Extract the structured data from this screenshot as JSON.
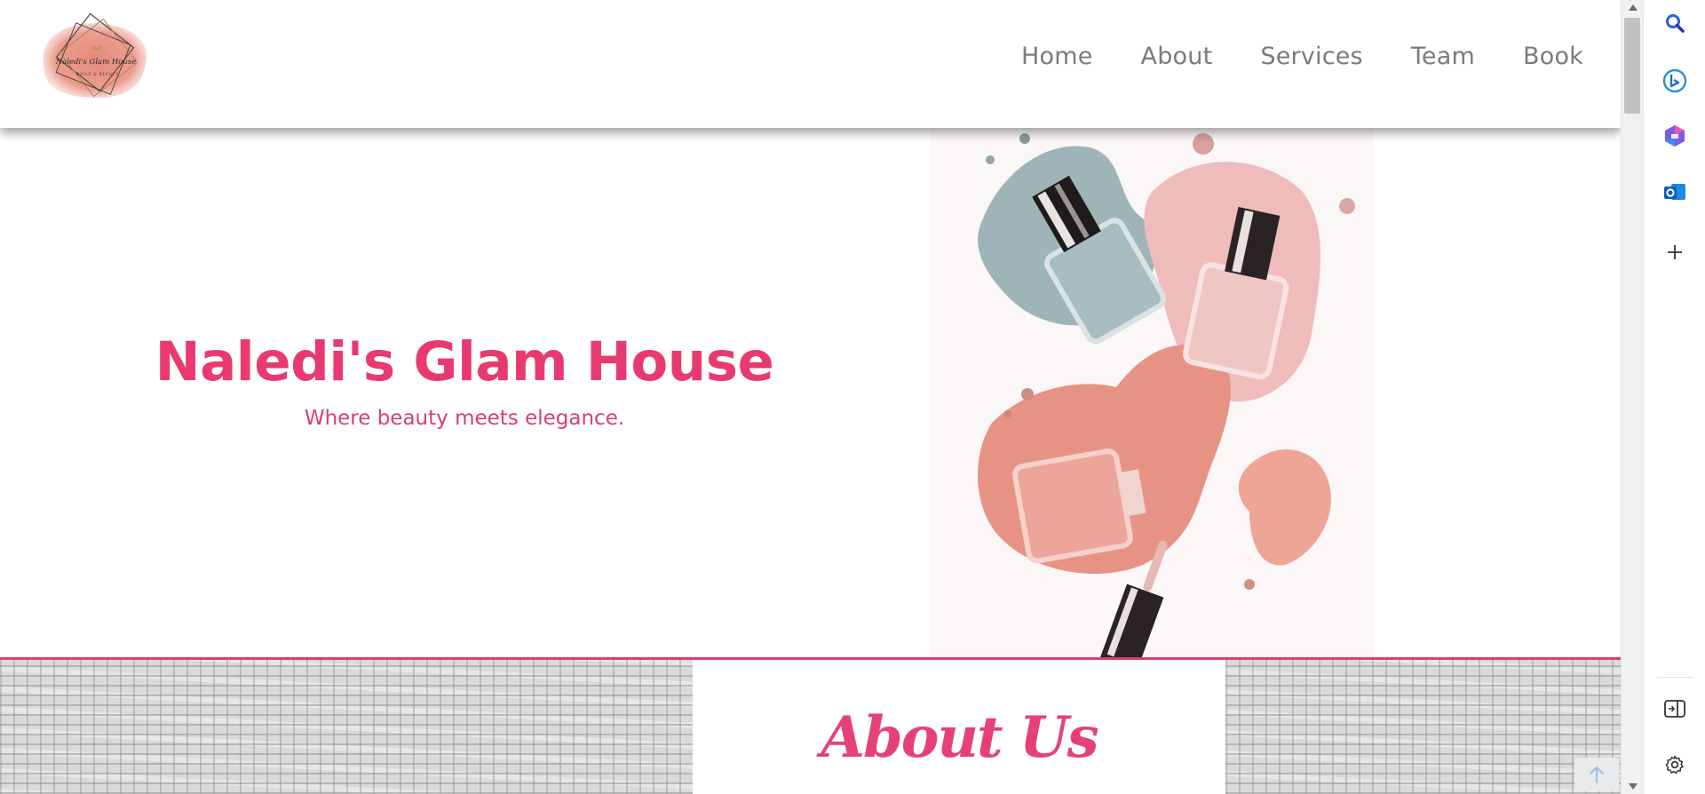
{
  "site": {
    "logo_alt": "Naledi's Glam House logo",
    "logo_script_text": "Naledi's Glam House",
    "logo_tagline": "NAILS & BEAUTY"
  },
  "nav": {
    "items": [
      {
        "label": "Home"
      },
      {
        "label": "About"
      },
      {
        "label": "Services"
      },
      {
        "label": "Team"
      },
      {
        "label": "Book"
      }
    ]
  },
  "hero": {
    "title": "Naledi's Glam House",
    "subtitle": "Where beauty meets elegance."
  },
  "about": {
    "title": "About Us"
  },
  "colors": {
    "brand_pink": "#e83a6f",
    "nav_text": "#7b7b7b",
    "divider": "#d9406c"
  },
  "sidebar": {
    "icons": [
      "search-icon",
      "bing-copilot-icon",
      "microsoft-365-icon",
      "outlook-icon",
      "add-icon",
      "split-screen-icon",
      "settings-icon"
    ]
  }
}
